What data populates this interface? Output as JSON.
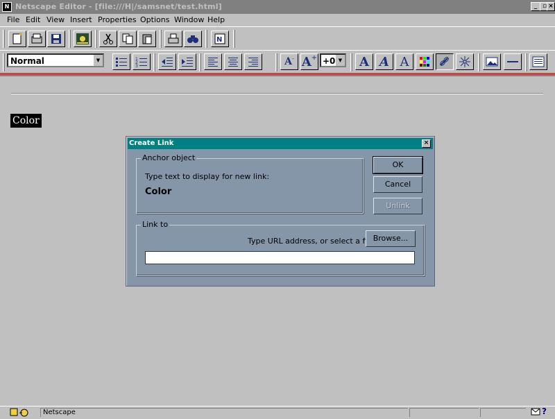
{
  "window": {
    "title": "Netscape Editor - [file:///H|/samsnet/test.html]",
    "app_icon": "netscape-icon"
  },
  "menu": [
    "File",
    "Edit",
    "View",
    "Insert",
    "Properties",
    "Options",
    "Window",
    "Help"
  ],
  "menu_access_keys": [
    "F",
    "E",
    "V",
    "I",
    "P",
    "O",
    "W",
    "H"
  ],
  "toolbar1_icons": [
    "new-doc-icon",
    "open-icon",
    "save-icon",
    "publish-icon",
    "cut-icon",
    "copy-icon",
    "paste-icon",
    "print-icon",
    "find-icon",
    "browse-icon"
  ],
  "format_toolbar": {
    "paragraph_style": "Normal",
    "font_size": "+0",
    "icons": [
      "bullet-list-icon",
      "numbered-list-icon",
      "decrease-indent-icon",
      "increase-indent-icon",
      "align-left-icon",
      "align-center-icon",
      "align-right-icon",
      "decrease-font-icon",
      "increase-font-icon",
      "bold-icon",
      "italic-icon",
      "fixed-width-icon",
      "color-icon",
      "link-icon",
      "target-icon",
      "image-icon",
      "hline-icon",
      "table-icon"
    ]
  },
  "document": {
    "selected_text": "Color"
  },
  "dialog": {
    "title": "Create Link",
    "anchor_group_label": "Anchor object",
    "anchor_prompt": "Type text to display for new link:",
    "anchor_text": "Color",
    "ok_label": "OK",
    "cancel_label": "Cancel",
    "unlink_label": "Unlink",
    "unlink_access_key": "n",
    "link_group_label": "Link to",
    "url_prompt": "Type URL address, or select a file:",
    "browse_label": "Browse...",
    "browse_access_key": "B",
    "url_value": ""
  },
  "status": {
    "text": "Netscape"
  },
  "colors": {
    "dialog_bg": "#8596a9",
    "dialog_titlebar": "#008080",
    "accent_red": "#d24040",
    "window_titlebar": "#808080"
  }
}
